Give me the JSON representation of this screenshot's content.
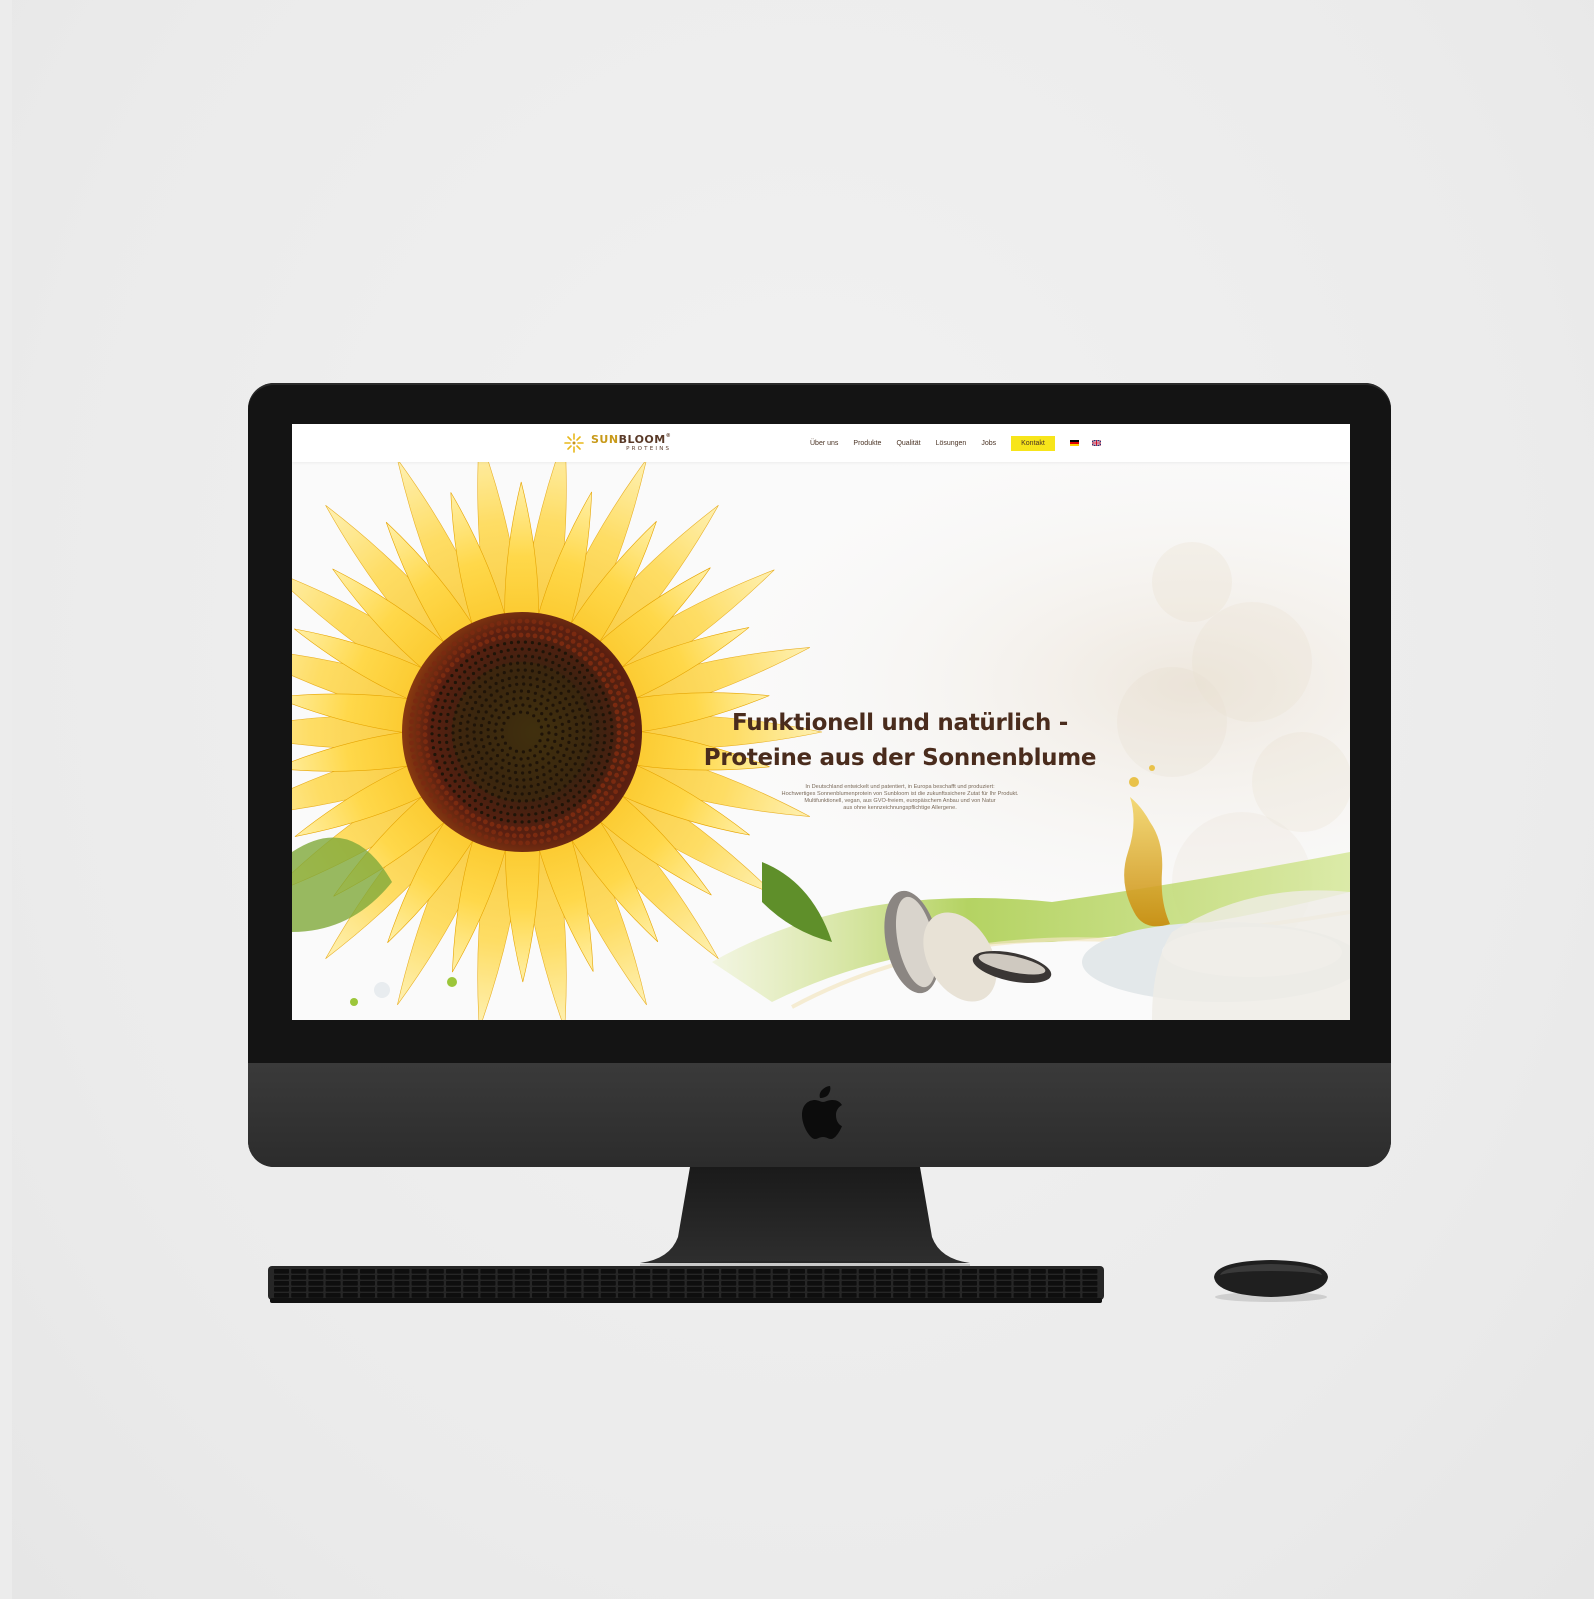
{
  "site": {
    "brand": {
      "name_part1": "SUN",
      "name_part2": "BLOOM",
      "registered": "®",
      "subtitle": "PROTEINS"
    },
    "nav": {
      "items": [
        {
          "label": "Über uns"
        },
        {
          "label": "Produkte"
        },
        {
          "label": "Qualität"
        },
        {
          "label": "Lösungen"
        },
        {
          "label": "Jobs"
        }
      ],
      "contact_label": "Kontakt",
      "languages": [
        "de-flag-icon",
        "uk-flag-icon"
      ]
    },
    "hero": {
      "title_line1": "Funktionell und natürlich -",
      "title_line2": "Proteine aus der Sonnenblume",
      "body_lines": [
        "In Deutschland entwickelt und patentiert, in Europa beschafft und produziert:",
        "Hochwertiges Sonnenblumenprotein von Sunbloom ist die zukunftssichere Zutat für Ihr Produkt.",
        "Multifunktionell, vegan, aus GVO-freiem, europäischem Anbau und von Natur",
        "aus ohne kennzeichnungspflichtige Allergene."
      ]
    }
  },
  "colors": {
    "brand_brown": "#4a2c1d",
    "brand_gold": "#c89a1a",
    "contact_button": "#f7e51a",
    "device_dark": "#141414"
  }
}
